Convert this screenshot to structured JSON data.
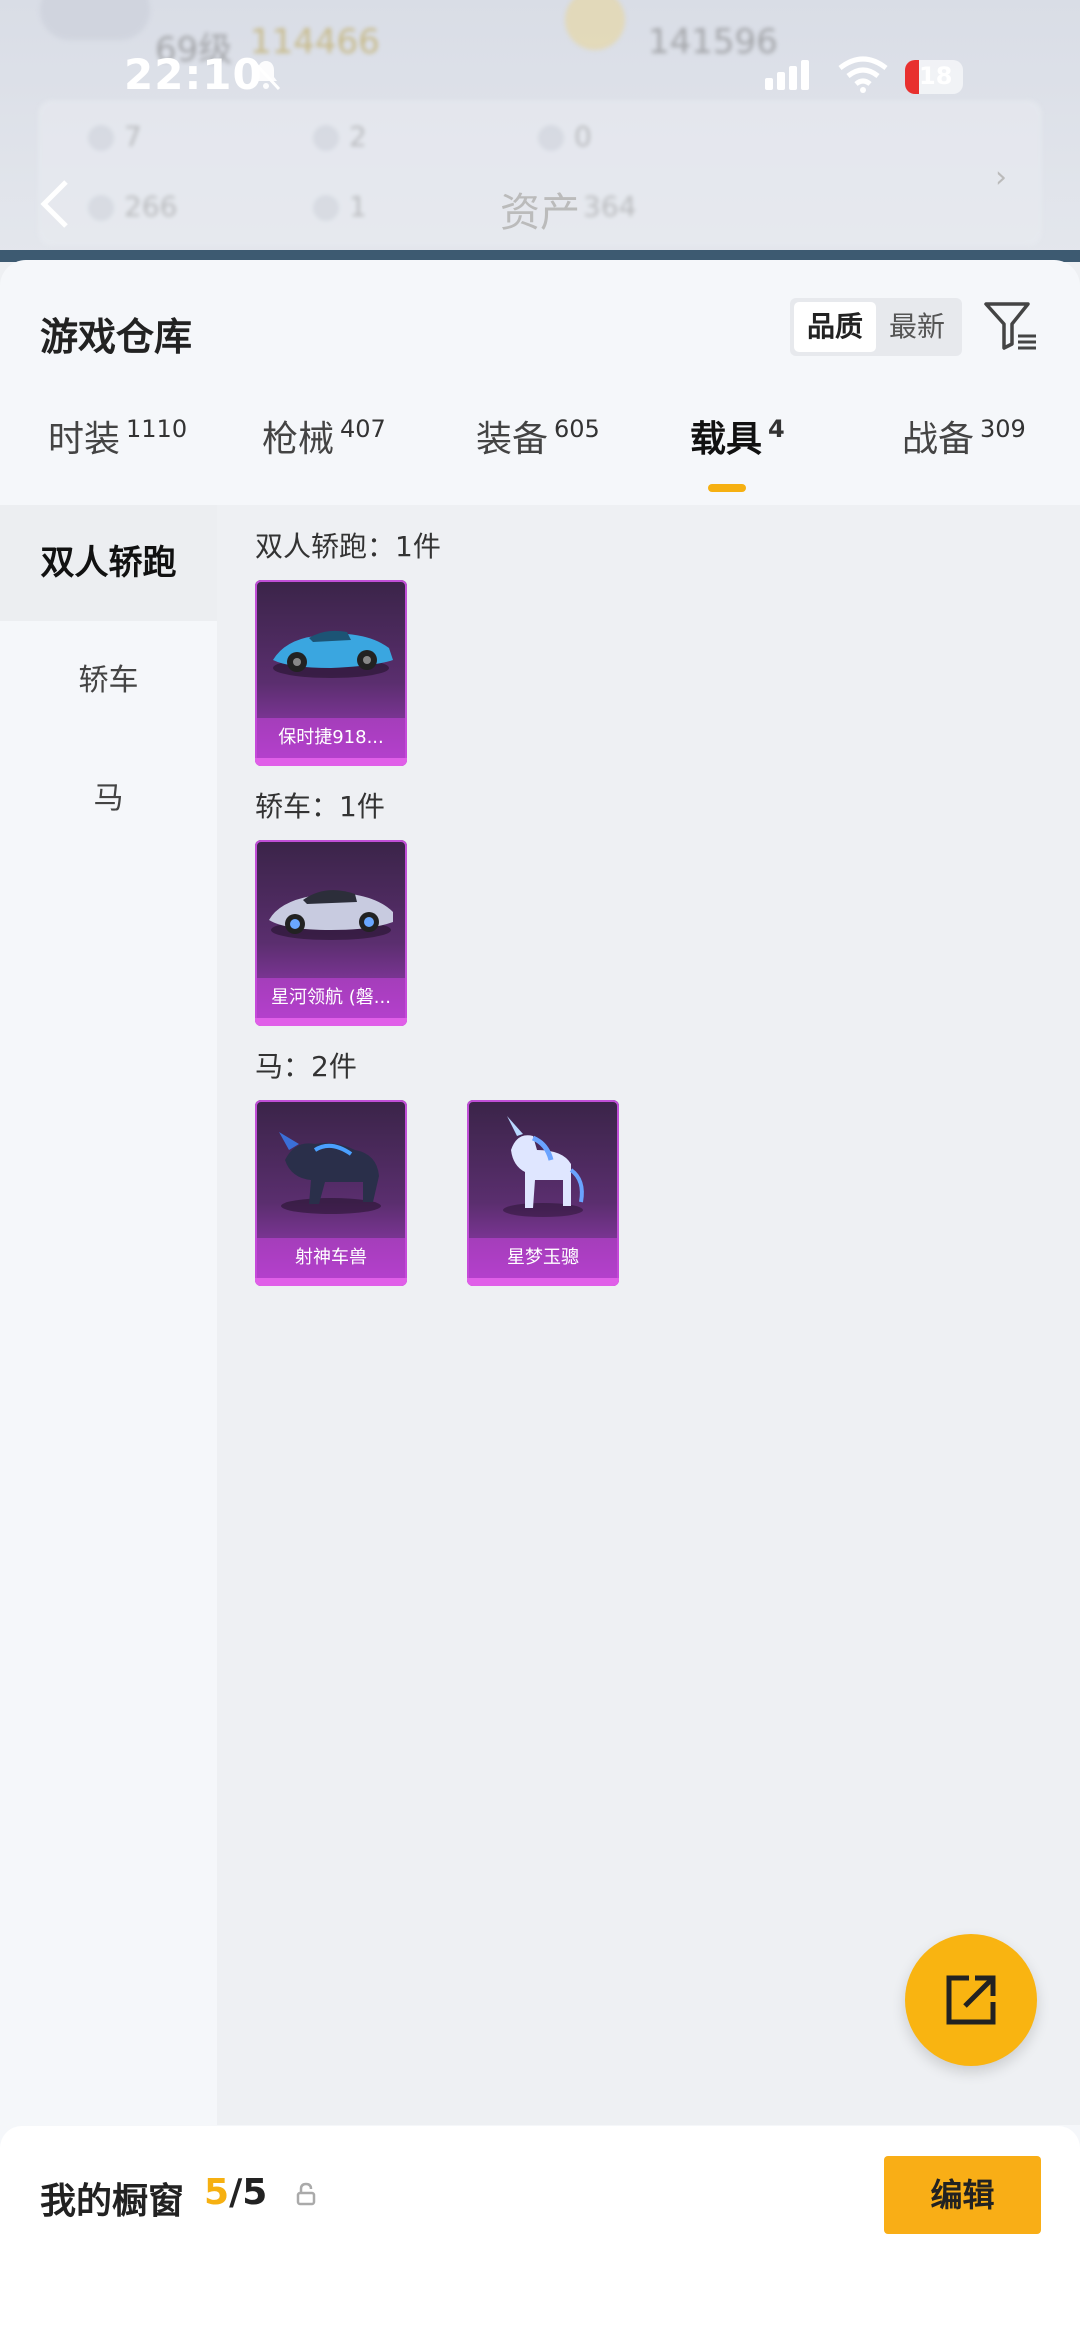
{
  "status_bar": {
    "time": "22:10",
    "battery": "18"
  },
  "background": {
    "level": "69级",
    "coins": "114466",
    "coins2": "141596",
    "stats": [
      "7",
      "2",
      "0",
      "266",
      "1"
    ],
    "assets_label": "资产",
    "assets_value": "364"
  },
  "sheet": {
    "title": "游戏仓库",
    "sort_options": [
      "品质",
      "最新"
    ],
    "tabs": [
      {
        "label": "时装",
        "count": "1110"
      },
      {
        "label": "枪械",
        "count": "407"
      },
      {
        "label": "装备",
        "count": "605"
      },
      {
        "label": "载具",
        "count": "4"
      },
      {
        "label": "战备",
        "count": "309"
      }
    ]
  },
  "sidebar": {
    "items": [
      "双人轿跑",
      "轿车",
      "马"
    ]
  },
  "sections": [
    {
      "title": "双人轿跑：1件",
      "items": [
        "保时捷918..."
      ]
    },
    {
      "title": "轿车：1件",
      "items": [
        "星河领航 (磐..."
      ]
    },
    {
      "title": "马：2件",
      "items": [
        "射神车兽",
        "星梦玉骢"
      ]
    }
  ],
  "footer": {
    "label": "我的橱窗",
    "count_current": "5",
    "count_total": "/5",
    "edit_label": "编辑"
  },
  "colors": {
    "accent": "#f9b411",
    "card_purple": "#a23cc0"
  }
}
